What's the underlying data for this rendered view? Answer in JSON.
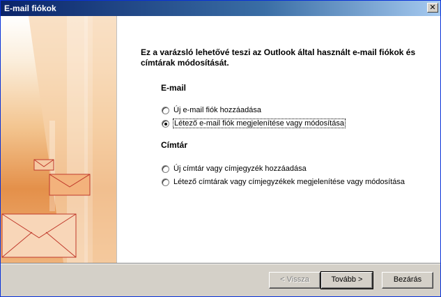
{
  "window": {
    "title": "E-mail fiókok",
    "close_symbol": "✕"
  },
  "wizard": {
    "heading": "Ez a varázsló lehetővé teszi az Outlook által használt e-mail fiókok és címtárak módosítását.",
    "email_section": {
      "label": "E-mail",
      "options": [
        {
          "label": "Új e-mail fiók hozzáadása",
          "checked": false
        },
        {
          "label": "Létező e-mail fiók megjelenítése vagy módosítása",
          "checked": true
        }
      ]
    },
    "directory_section": {
      "label": "Címtár",
      "options": [
        {
          "label": "Új címtár vagy címjegyzék hozzáadása",
          "checked": false
        },
        {
          "label": "Létező címtárak vagy címjegyzékek megjelenítése vagy módosítása",
          "checked": false
        }
      ]
    }
  },
  "buttons": {
    "back": "< Vissza",
    "next": "Tovább >",
    "close": "Bezárás"
  },
  "colors": {
    "titlebar": "#0a246a",
    "art_accent": "#e4904a"
  }
}
